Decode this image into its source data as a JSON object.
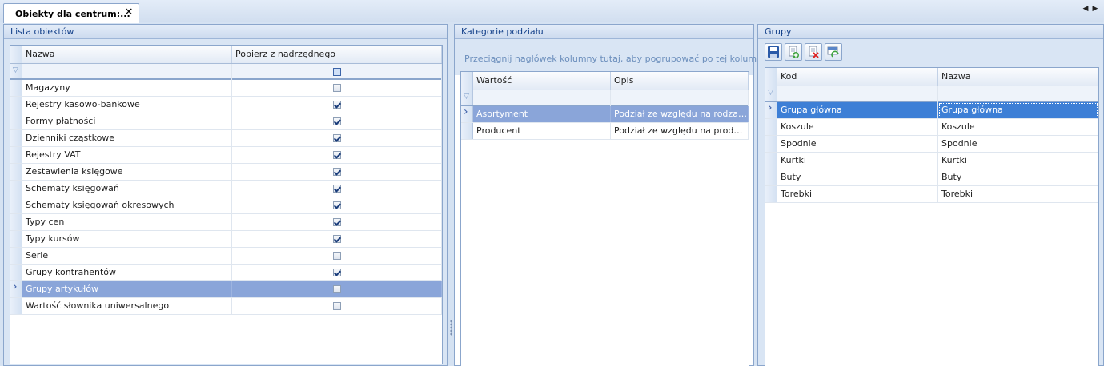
{
  "tab": {
    "title": "Obiekty dla centrum:...",
    "close": "✕"
  },
  "nav": {
    "prev": "◀",
    "next": "▶"
  },
  "panels": {
    "objects": {
      "title": "Lista obiektów",
      "columns": [
        "Nazwa",
        "Pobierz z nadrzędnego"
      ],
      "rows": [
        {
          "name": "Magazyny",
          "checked": false
        },
        {
          "name": "Rejestry kasowo-bankowe",
          "checked": true
        },
        {
          "name": "Formy płatności",
          "checked": true
        },
        {
          "name": "Dzienniki cząstkowe",
          "checked": true
        },
        {
          "name": "Rejestry VAT",
          "checked": true
        },
        {
          "name": "Zestawienia księgowe",
          "checked": true
        },
        {
          "name": "Schematy księgowań",
          "checked": true
        },
        {
          "name": "Schematy księgowań okresowych",
          "checked": true
        },
        {
          "name": "Typy cen",
          "checked": true
        },
        {
          "name": "Typy kursów",
          "checked": true
        },
        {
          "name": "Serie",
          "checked": false
        },
        {
          "name": "Grupy kontrahentów",
          "checked": true
        },
        {
          "name": "Grupy artykułów",
          "checked": false,
          "selected": true
        },
        {
          "name": "Wartość słownika uniwersalnego",
          "checked": false
        }
      ]
    },
    "categories": {
      "title": "Kategorie podziału",
      "group_hint": "Przeciągnij nagłówek kolumny tutaj, aby pogrupować po tej kolumnie.",
      "columns": [
        "Wartość",
        "Opis"
      ],
      "rows": [
        {
          "value": "Asortyment",
          "desc": "Podział ze względu na rodzaj ar...",
          "selected": true
        },
        {
          "value": "Producent",
          "desc": "Podział ze względu na producen..."
        }
      ]
    },
    "groups": {
      "title": "Grupy",
      "toolbar": [
        "save-icon",
        "add-icon",
        "delete-icon",
        "refresh-icon"
      ],
      "columns": [
        "Kod",
        "Nazwa"
      ],
      "rows": [
        {
          "kod": "Grupa główna",
          "nazwa": "Grupa główna",
          "selected": true
        },
        {
          "kod": "Koszule",
          "nazwa": "Koszule"
        },
        {
          "kod": "Spodnie",
          "nazwa": "Spodnie"
        },
        {
          "kod": "Kurtki",
          "nazwa": "Kurtki"
        },
        {
          "kod": "Buty",
          "nazwa": "Buty"
        },
        {
          "kod": "Torebki",
          "nazwa": "Torebki"
        }
      ]
    }
  },
  "colors": {
    "header_text": "#15428b",
    "selection": "#8aa5d9",
    "selection_active": "#3d7fd6",
    "border": "#8ba6cc"
  }
}
